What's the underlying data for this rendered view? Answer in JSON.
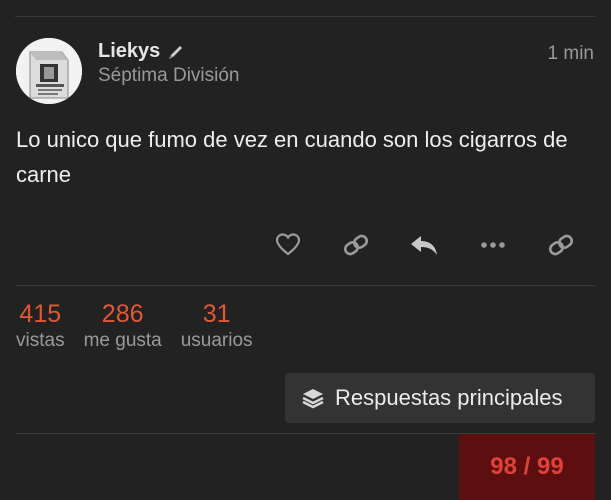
{
  "post": {
    "username": "Liekys",
    "user_title": "Séptima División",
    "time": "1 min",
    "body": "Lo unico que fumo de vez en cuando son los cigarros de carne"
  },
  "actions": [
    "heart-icon",
    "link-icon",
    "reply-icon",
    "more-icon",
    "link-icon"
  ],
  "stats": [
    {
      "value": "415",
      "label": "vistas"
    },
    {
      "value": "286",
      "label": "me gusta"
    },
    {
      "value": "31",
      "label": "usuarios"
    }
  ],
  "top_replies": {
    "label": "Respuestas principales"
  },
  "progress": {
    "text": "98 / 99"
  },
  "colors": {
    "accent": "#e45735",
    "progress_bg": "#5d0f0f",
    "background": "#222222"
  }
}
